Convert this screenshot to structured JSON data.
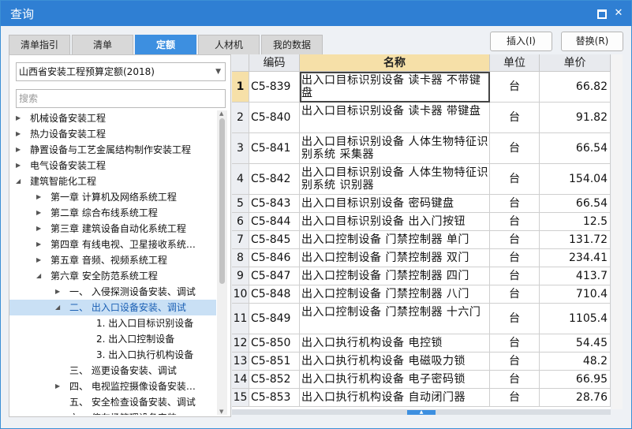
{
  "window": {
    "title": "查询",
    "max_glyph": "",
    "close_glyph": "✕"
  },
  "tabs": [
    "清单指引",
    "清单",
    "定额",
    "人材机",
    "我的数据"
  ],
  "active_tab": 2,
  "actions": {
    "insert": "插入(I)",
    "replace": "替换(R)"
  },
  "library": {
    "selected": "山西省安装工程预算定额(2018)"
  },
  "search": {
    "placeholder": "搜索"
  },
  "tree": [
    {
      "label": "机械设备安装工程",
      "level": 0,
      "twisty": "right"
    },
    {
      "label": "热力设备安装工程",
      "level": 0,
      "twisty": "right"
    },
    {
      "label": "静置设备与工艺金属结构制作安装工程",
      "level": 0,
      "twisty": "right"
    },
    {
      "label": "电气设备安装工程",
      "level": 0,
      "twisty": "right"
    },
    {
      "label": "建筑智能化工程",
      "level": 0,
      "twisty": "down"
    },
    {
      "label": "第一章 计算机及网络系统工程",
      "level": 1,
      "twisty": "right"
    },
    {
      "label": "第二章 综合布线系统工程",
      "level": 1,
      "twisty": "right"
    },
    {
      "label": "第三章 建筑设备自动化系统工程",
      "level": 1,
      "twisty": "right"
    },
    {
      "label": "第四章 有线电视、卫星接收系统…",
      "level": 1,
      "twisty": "right"
    },
    {
      "label": "第五章 音频、视频系统工程",
      "level": 1,
      "twisty": "right"
    },
    {
      "label": "第六章 安全防范系统工程",
      "level": 1,
      "twisty": "down"
    },
    {
      "label": "一、 入侵探测设备安装、调试",
      "level": 2,
      "twisty": "right"
    },
    {
      "label": "二、 出入口设备安装、调试",
      "level": 2,
      "twisty": "down",
      "selected": true
    },
    {
      "label": "1. 出入口目标识别设备",
      "level": 3,
      "twisty": ""
    },
    {
      "label": "2. 出入口控制设备",
      "level": 3,
      "twisty": ""
    },
    {
      "label": "3. 出入口执行机构设备",
      "level": 3,
      "twisty": ""
    },
    {
      "label": "三、 巡更设备安装、调试",
      "level": 2,
      "twisty": ""
    },
    {
      "label": "四、 电视监控摄像设备安装…",
      "level": 2,
      "twisty": "right"
    },
    {
      "label": "五、 安全检查设备安装、调试",
      "level": 2,
      "twisty": ""
    },
    {
      "label": "六、 停车场管理设备安装…",
      "level": 2,
      "twisty": ""
    }
  ],
  "grid": {
    "headers": [
      "",
      "编码",
      "名称",
      "单位",
      "单价"
    ],
    "rows": [
      {
        "no": "1",
        "code": "C5-839",
        "name": "出入口目标识别设备 读卡器 不带键盘",
        "unit": "台",
        "price": "66.82"
      },
      {
        "no": "2",
        "code": "C5-840",
        "name": "出入口目标识别设备 读卡器 带键盘",
        "unit": "台",
        "price": "91.82"
      },
      {
        "no": "3",
        "code": "C5-841",
        "name": "出入口目标识别设备 人体生物特征识别系统 采集器",
        "unit": "台",
        "price": "66.54"
      },
      {
        "no": "4",
        "code": "C5-842",
        "name": "出入口目标识别设备 人体生物特征识别系统 识别器",
        "unit": "台",
        "price": "154.04"
      },
      {
        "no": "5",
        "code": "C5-843",
        "name": "出入口目标识别设备 密码键盘",
        "unit": "台",
        "price": "66.54"
      },
      {
        "no": "6",
        "code": "C5-844",
        "name": "出入口目标识别设备 出入门按钮",
        "unit": "台",
        "price": "12.5"
      },
      {
        "no": "7",
        "code": "C5-845",
        "name": "出入口控制设备 门禁控制器 单门",
        "unit": "台",
        "price": "131.72"
      },
      {
        "no": "8",
        "code": "C5-846",
        "name": "出入口控制设备 门禁控制器 双门",
        "unit": "台",
        "price": "234.41"
      },
      {
        "no": "9",
        "code": "C5-847",
        "name": "出入口控制设备 门禁控制器 四门",
        "unit": "台",
        "price": "413.7"
      },
      {
        "no": "10",
        "code": "C5-848",
        "name": "出入口控制设备 门禁控制器 八门",
        "unit": "台",
        "price": "710.4"
      },
      {
        "no": "11",
        "code": "C5-849",
        "name": "出入口控制设备 门禁控制器 十六门",
        "unit": "台",
        "price": "1105.4"
      },
      {
        "no": "12",
        "code": "C5-850",
        "name": "出入口执行机构设备 电控锁",
        "unit": "台",
        "price": "54.45"
      },
      {
        "no": "13",
        "code": "C5-851",
        "name": "出入口执行机构设备 电磁吸力锁",
        "unit": "台",
        "price": "48.2"
      },
      {
        "no": "14",
        "code": "C5-852",
        "name": "出入口执行机构设备 电子密码锁",
        "unit": "台",
        "price": "66.95"
      },
      {
        "no": "15",
        "code": "C5-853",
        "name": "出入口执行机构设备 自动闭门器",
        "unit": "台",
        "price": "28.76"
      }
    ]
  },
  "colors": {
    "titlebar": "#2f7fd3",
    "active_tab": "#3d8fe0",
    "name_header": "#f6e0a8",
    "selected_tree": "#c9e0f5"
  }
}
